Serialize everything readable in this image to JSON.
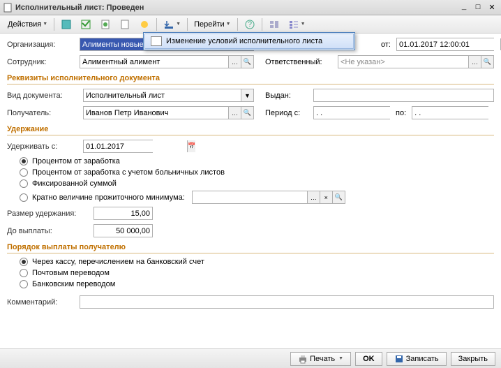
{
  "title": "Исполнительный лист: Проведен",
  "toolbar": {
    "actions": "Действия",
    "goto": "Перейти"
  },
  "dropdown": {
    "item1": "Изменение условий исполнительного листа"
  },
  "fields": {
    "org_label": "Организация:",
    "org_value": "Алименты новые!!!",
    "from_label": "от:",
    "from_value": "01.01.2017 12:00:01",
    "emp_label": "Сотрудник:",
    "emp_value": "Алиментный алимент",
    "resp_label": "Ответственный:",
    "resp_value": "<Не указан>",
    "doc_type_label": "Вид документа:",
    "doc_type_value": "Исполнительный лист",
    "issued_label": "Выдан:",
    "issued_value": "",
    "recipient_label": "Получатель:",
    "recipient_value": "Иванов Петр Иванович",
    "period_from_label": "Период с:",
    "period_from_value": ". .",
    "period_to_label": "по:",
    "period_to_value": ". .",
    "withhold_from_label": "Удерживать с:",
    "withhold_from_value": "01.01.2017",
    "amount_label": "Размер удержания:",
    "amount_value": "15,00",
    "until_label": "До выплаты:",
    "until_value": "50 000,00",
    "comment_label": "Комментарий:",
    "comment_value": ""
  },
  "sections": {
    "requisites": "Реквизиты исполнительного документа",
    "withholding": "Удержание",
    "payment_order": "Порядок выплаты получателю"
  },
  "radios": {
    "r1": "Процентом от заработка",
    "r2": "Процентом от заработка с учетом больничных листов",
    "r3": "Фиксированной суммой",
    "r4": "Кратно величине прожиточного минимума:",
    "r5": "Через кассу, перечислением на банковский счет",
    "r6": "Почтовым переводом",
    "r7": "Банковским переводом"
  },
  "footer": {
    "print": "Печать",
    "ok": "OK",
    "save": "Записать",
    "close": "Закрыть"
  }
}
